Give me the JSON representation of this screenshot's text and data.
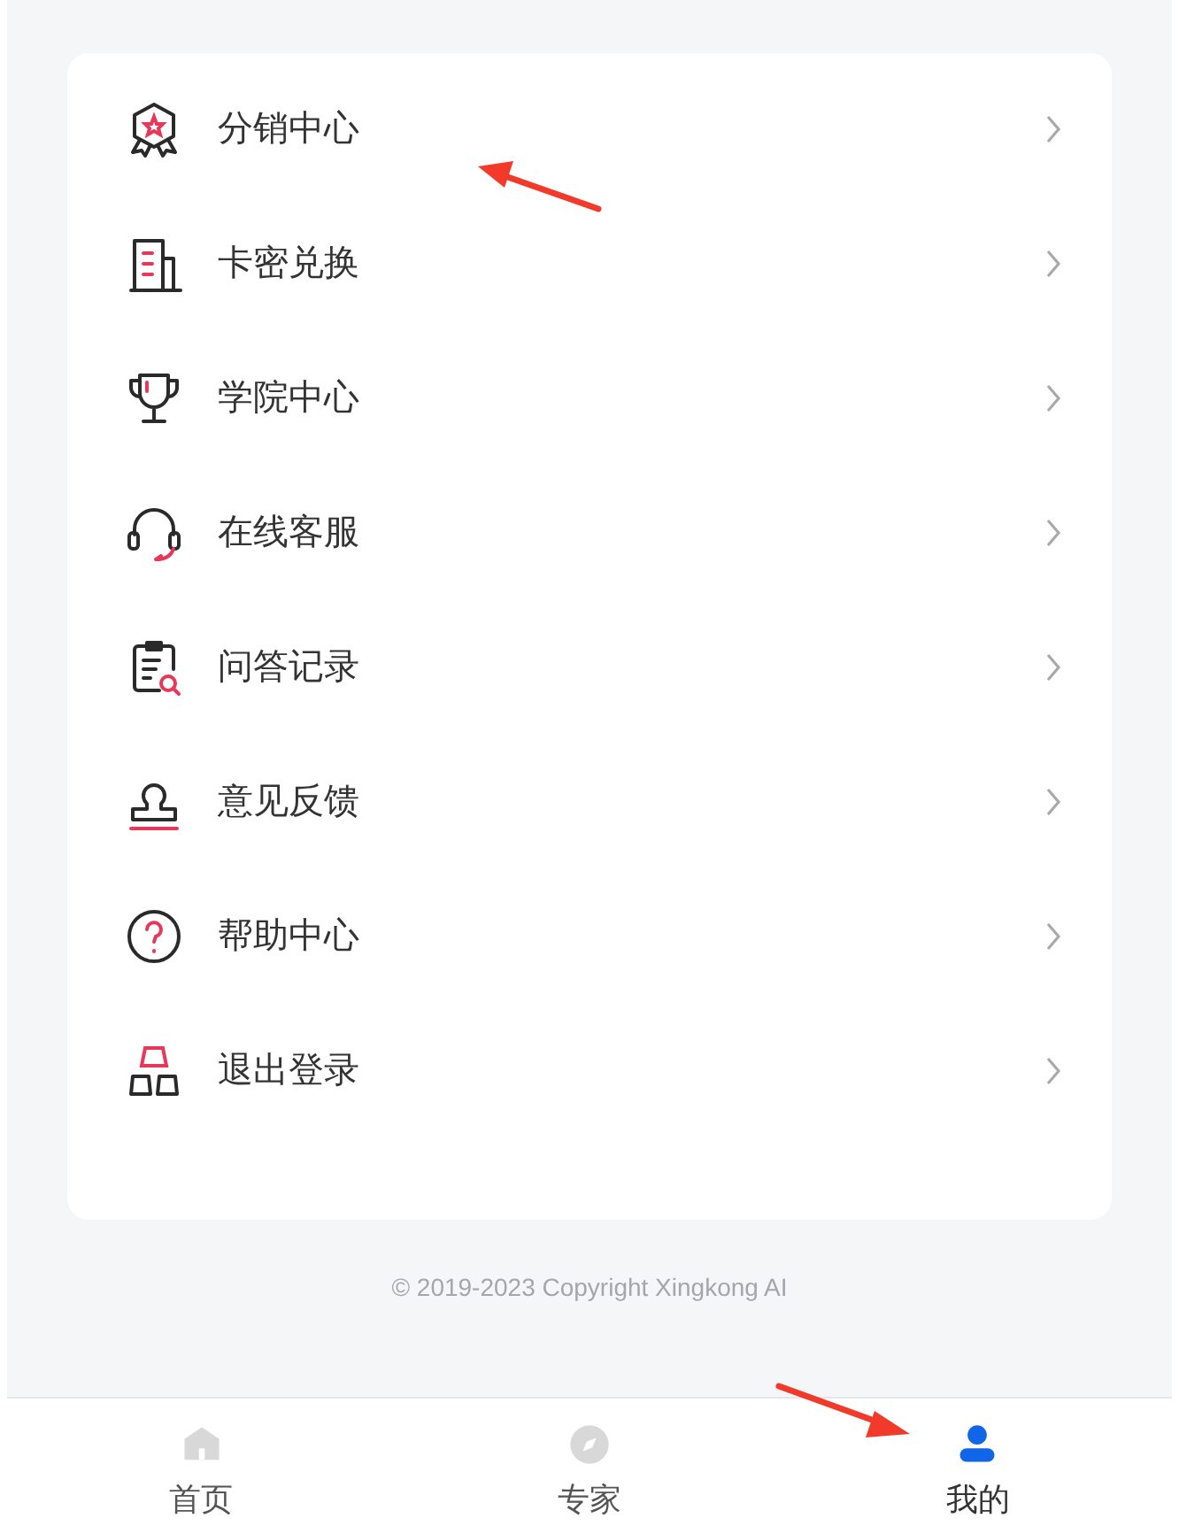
{
  "menu": [
    {
      "label": "分销中心"
    },
    {
      "label": "卡密兑换"
    },
    {
      "label": "学院中心"
    },
    {
      "label": "在线客服"
    },
    {
      "label": "问答记录"
    },
    {
      "label": "意见反馈"
    },
    {
      "label": "帮助中心"
    },
    {
      "label": "退出登录"
    }
  ],
  "footer": "© 2019-2023 Copyright Xingkong AI",
  "tab_bar": [
    {
      "label": "首页",
      "selected": false
    },
    {
      "label": "专家",
      "selected": false
    },
    {
      "label": "我的",
      "selected": true
    }
  ]
}
